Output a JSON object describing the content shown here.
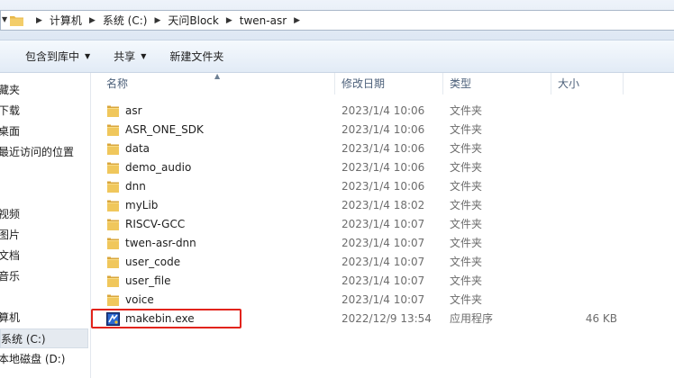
{
  "address_bar": {
    "crumbs": [
      "计算机",
      "系统 (C:)",
      "天问Block",
      "twen-asr"
    ]
  },
  "toolbar": {
    "include_library": "包含到库中",
    "share": "共享",
    "new_folder": "新建文件夹"
  },
  "nav": {
    "items": [
      "藏夹",
      "下载",
      "桌面",
      "最近访问的位置",
      "视频",
      "图片",
      "文档",
      "音乐",
      "算机",
      "系统 (C:)",
      "本地磁盘 (D:)"
    ]
  },
  "columns": {
    "name": "名称",
    "date": "修改日期",
    "type": "类型",
    "size": "大小"
  },
  "files": [
    {
      "name": "asr",
      "date": "2023/1/4 10:06",
      "type": "文件夹",
      "size": "",
      "icon": "folder-icon"
    },
    {
      "name": "ASR_ONE_SDK",
      "date": "2023/1/4 10:06",
      "type": "文件夹",
      "size": "",
      "icon": "folder-icon"
    },
    {
      "name": "data",
      "date": "2023/1/4 10:06",
      "type": "文件夹",
      "size": "",
      "icon": "folder-icon"
    },
    {
      "name": "demo_audio",
      "date": "2023/1/4 10:06",
      "type": "文件夹",
      "size": "",
      "icon": "folder-icon"
    },
    {
      "name": "dnn",
      "date": "2023/1/4 10:06",
      "type": "文件夹",
      "size": "",
      "icon": "folder-icon"
    },
    {
      "name": "myLib",
      "date": "2023/1/4 18:02",
      "type": "文件夹",
      "size": "",
      "icon": "folder-icon"
    },
    {
      "name": "RISCV-GCC",
      "date": "2023/1/4 10:07",
      "type": "文件夹",
      "size": "",
      "icon": "folder-icon"
    },
    {
      "name": "twen-asr-dnn",
      "date": "2023/1/4 10:07",
      "type": "文件夹",
      "size": "",
      "icon": "folder-icon"
    },
    {
      "name": "user_code",
      "date": "2023/1/4 10:07",
      "type": "文件夹",
      "size": "",
      "icon": "folder-icon"
    },
    {
      "name": "user_file",
      "date": "2023/1/4 10:07",
      "type": "文件夹",
      "size": "",
      "icon": "folder-icon"
    },
    {
      "name": "voice",
      "date": "2023/1/4 10:07",
      "type": "文件夹",
      "size": "",
      "icon": "folder-icon"
    },
    {
      "name": "makebin.exe",
      "date": "2022/12/9 13:54",
      "type": "应用程序",
      "size": "46 KB",
      "icon": "exe-icon"
    }
  ],
  "colors": {
    "highlight": "#e2231a",
    "folder": "#e8b84a"
  }
}
